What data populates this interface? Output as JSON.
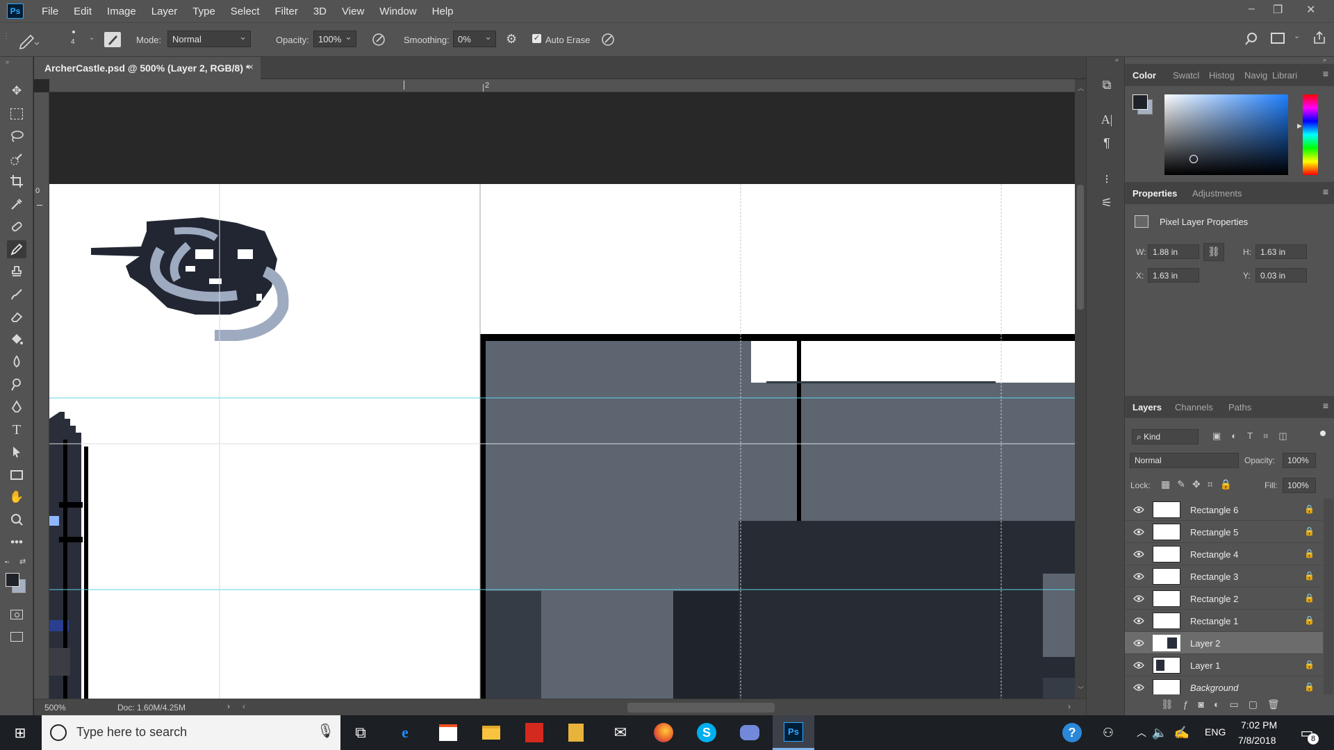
{
  "app": {
    "logo": "Ps",
    "menus": [
      "File",
      "Edit",
      "Image",
      "Layer",
      "Type",
      "Select",
      "Filter",
      "3D",
      "View",
      "Window",
      "Help"
    ],
    "window_controls": [
      "–",
      "❐",
      "✕"
    ]
  },
  "options": {
    "brush_size": "4",
    "mode_label": "Mode:",
    "mode_value": "Normal",
    "opacity_label": "Opacity:",
    "opacity_value": "100%",
    "smoothing_label": "Smoothing:",
    "smoothing_value": "0%",
    "auto_erase_label": "Auto Erase",
    "auto_erase_checked": true
  },
  "document": {
    "tab_title": "ArcherCastle.psd @ 500% (Layer 2, RGB/8) *",
    "close": "×",
    "ruler_label": "2",
    "ruler_left_label": "0",
    "zoom": "500%",
    "doc_info": "Doc: 1.60M/4.25M"
  },
  "color_panel": {
    "tabs": [
      "Color",
      "Swatcl",
      "Histog",
      "Navig",
      "Librari"
    ],
    "active_tab": "Color",
    "foreground": "#1f2329",
    "background": "#a5b1c2"
  },
  "properties_panel": {
    "tabs": [
      "Properties",
      "Adjustments"
    ],
    "title": "Pixel Layer Properties",
    "w_label": "W:",
    "w_value": "1.88 in",
    "h_label": "H:",
    "h_value": "1.63 in",
    "x_label": "X:",
    "x_value": "1.63 in",
    "y_label": "Y:",
    "y_value": "0.03 in"
  },
  "layers_panel": {
    "tabs": [
      "Layers",
      "Channels",
      "Paths"
    ],
    "filter_kind": "Kind",
    "blend_mode": "Normal",
    "opacity_label": "Opacity:",
    "opacity_value": "100%",
    "lock_label": "Lock:",
    "fill_label": "Fill:",
    "fill_value": "100%",
    "layers": [
      {
        "name": "Rectangle 6",
        "locked": true,
        "selected": false
      },
      {
        "name": "Rectangle 5",
        "locked": true,
        "selected": false
      },
      {
        "name": "Rectangle 4",
        "locked": true,
        "selected": false
      },
      {
        "name": "Rectangle 3",
        "locked": true,
        "selected": false
      },
      {
        "name": "Rectangle 2",
        "locked": true,
        "selected": false
      },
      {
        "name": "Rectangle 1",
        "locked": true,
        "selected": false
      },
      {
        "name": "Layer 2",
        "locked": false,
        "selected": true
      },
      {
        "name": "Layer 1",
        "locked": true,
        "selected": false
      },
      {
        "name": "Background",
        "locked": true,
        "selected": false
      }
    ]
  },
  "taskbar": {
    "search_placeholder": "Type here to search",
    "language": "ENG",
    "time": "7:02 PM",
    "date": "7/8/2018",
    "notification_count": "8"
  }
}
